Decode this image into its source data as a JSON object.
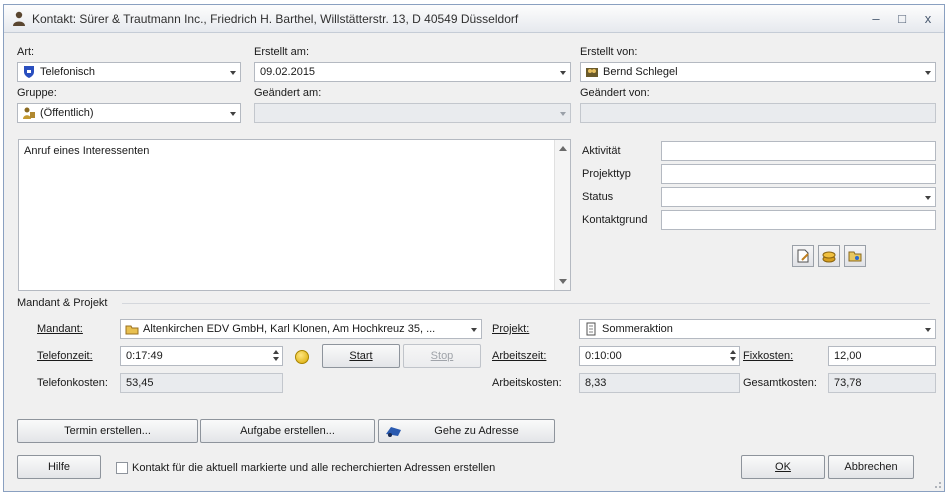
{
  "window": {
    "title": "Kontakt: Sürer & Trautmann Inc., Friedrich H. Barthel, Willstätterstr. 13, D 40549 Düsseldorf",
    "minimize": "–",
    "maximize": "□",
    "close": "x"
  },
  "top": {
    "art": {
      "label": "Art:",
      "value": "Telefonisch"
    },
    "erstellt_am": {
      "label": "Erstellt am:",
      "value": "09.02.2015"
    },
    "erstellt_von": {
      "label": "Erstellt von:",
      "value": "Bernd Schlegel"
    },
    "gruppe": {
      "label": "Gruppe:",
      "value": "(Öffentlich)"
    },
    "geaendert_am": {
      "label": "Geändert am:",
      "value": ""
    },
    "geaendert_von": {
      "label": "Geändert von:",
      "value": ""
    }
  },
  "memo": {
    "text": "Anruf eines Interessenten"
  },
  "side": {
    "aktivitaet": {
      "label": "Aktivität",
      "value": ""
    },
    "projekttyp": {
      "label": "Projekttyp",
      "value": ""
    },
    "status": {
      "label": "Status",
      "value": ""
    },
    "kontaktgrund": {
      "label": "Kontaktgrund",
      "value": ""
    }
  },
  "mandant_projekt": {
    "group_label": "Mandant & Projekt",
    "mandant": {
      "label": "Mandant:",
      "value": "Altenkirchen EDV GmbH, Karl Klonen, Am Hochkreuz 35, ..."
    },
    "projekt": {
      "label": "Projekt:",
      "value": "Sommeraktion"
    },
    "telefonzeit": {
      "label": "Telefonzeit:",
      "value": "0:17:49"
    },
    "start_label": "Start",
    "stop_label": "Stop",
    "arbeitszeit": {
      "label": "Arbeitszeit:",
      "value": "0:10:00"
    },
    "fixkosten": {
      "label": "Fixkosten:",
      "value": "12,00"
    },
    "telefonkosten": {
      "label": "Telefonkosten:",
      "value": "53,45"
    },
    "arbeitskosten": {
      "label": "Arbeitskosten:",
      "value": "8,33"
    },
    "gesamtkosten": {
      "label": "Gesamtkosten:",
      "value": "73,78"
    }
  },
  "actions": {
    "termin": "Termin erstellen...",
    "aufgabe": "Aufgabe erstellen...",
    "adresse": "Gehe zu Adresse"
  },
  "footer": {
    "hilfe": "Hilfe",
    "checkbox_label": "Kontakt für die aktuell markierte und alle recherchierten Adressen erstellen",
    "ok": "OK",
    "abbrechen": "Abbrechen"
  },
  "colors": {
    "accent": "#1f4fa8",
    "readonly_bg": "#e9ebee",
    "window_bg": "#f0f0f0"
  }
}
